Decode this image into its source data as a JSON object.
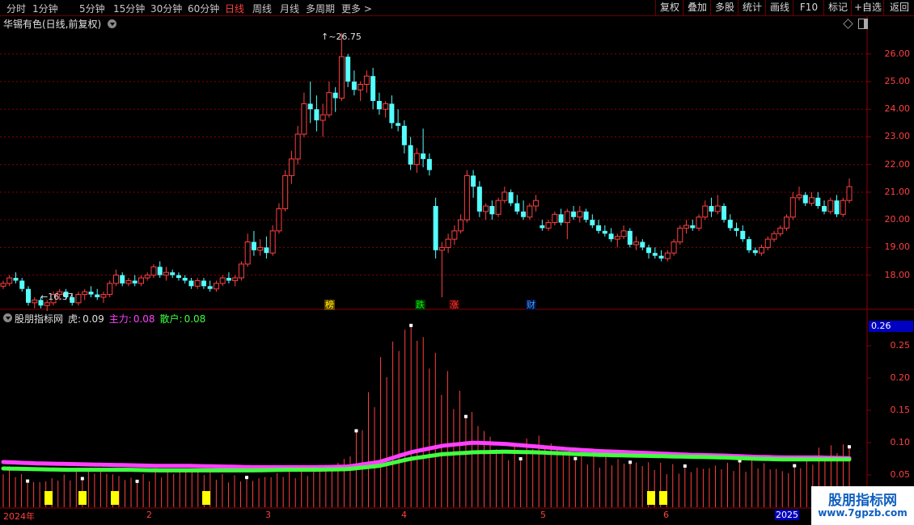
{
  "toolbar": {
    "periods": [
      "分时",
      "1分钟",
      "5分钟",
      "15分钟",
      "30分钟",
      "60分钟",
      "日线",
      "周线",
      "月线",
      "多周期",
      "更多 >"
    ],
    "active_period": "日线",
    "buttons": [
      "复权",
      "叠加",
      "多股",
      "统计",
      "画线",
      "F10",
      "标记",
      "+自选",
      "返回"
    ]
  },
  "stock": {
    "title": "华锡有色(日线,前复权)"
  },
  "price_axis": {
    "ticks": [
      "26.00",
      "25.00",
      "24.00",
      "23.00",
      "22.00",
      "21.00",
      "20.00",
      "19.00",
      "18.00"
    ]
  },
  "annotations": {
    "high": "26.75",
    "low": "16.57"
  },
  "tags": [
    {
      "text": "榜",
      "color": "#ffff00",
      "bg": "#604000"
    },
    {
      "text": "跌",
      "color": "#00ff00",
      "bg": "#003000"
    },
    {
      "text": "涨",
      "color": "#ff4040",
      "bg": "#400000"
    },
    {
      "text": "财",
      "color": "#40a0ff",
      "bg": "#001040"
    }
  ],
  "indicator": {
    "name": "股朋指标网",
    "tiger": {
      "label": "虎:",
      "value": "0.09"
    },
    "main_force": {
      "label": "主力:",
      "value": "0.08"
    },
    "retail": {
      "label": "散户:",
      "value": "0.08"
    },
    "current_value": "0.26",
    "ticks": [
      "0.25",
      "0.20",
      "0.15",
      "0.10",
      "0.05"
    ]
  },
  "time_axis": {
    "labels": [
      "2024年",
      "2",
      "3",
      "4",
      "5",
      "6"
    ],
    "year_box": "2025"
  },
  "watermark": {
    "line1": "股朋指标网",
    "line2": "www.7gpzb.com"
  },
  "colors": {
    "up": "#ff4040",
    "down": "#54ffff",
    "main_force": "#ff40ff",
    "retail": "#40ff40",
    "grid": "#8b0000"
  },
  "chart_data": [
    {
      "type": "candlestick",
      "title": "华锡有色(日线,前复权)",
      "ylim": [
        17.2,
        26.9
      ],
      "ohlc": [
        [
          17.6,
          17.8,
          17.5,
          17.7
        ],
        [
          17.7,
          18.0,
          17.6,
          17.9
        ],
        [
          17.9,
          18.1,
          17.7,
          17.8
        ],
        [
          17.8,
          17.9,
          17.4,
          17.5
        ],
        [
          17.5,
          17.6,
          16.9,
          17.0
        ],
        [
          17.0,
          17.2,
          16.8,
          17.1
        ],
        [
          17.1,
          17.2,
          16.8,
          16.9
        ],
        [
          16.9,
          17.1,
          16.7,
          17.0
        ],
        [
          17.0,
          17.4,
          16.9,
          17.3
        ],
        [
          17.3,
          17.5,
          17.1,
          17.4
        ],
        [
          17.4,
          17.5,
          17.1,
          17.2
        ],
        [
          17.2,
          17.3,
          16.9,
          17.0
        ],
        [
          17.0,
          17.4,
          16.9,
          17.3
        ],
        [
          17.3,
          17.5,
          17.1,
          17.4
        ],
        [
          17.4,
          17.6,
          17.2,
          17.3
        ],
        [
          17.3,
          17.5,
          17.1,
          17.2
        ],
        [
          17.2,
          17.4,
          17.0,
          17.3
        ],
        [
          17.3,
          17.8,
          17.2,
          17.7
        ],
        [
          17.7,
          18.2,
          17.6,
          18.0
        ],
        [
          18.0,
          18.1,
          17.6,
          17.7
        ],
        [
          17.7,
          17.9,
          17.6,
          17.8
        ],
        [
          17.8,
          18.0,
          17.6,
          17.7
        ],
        [
          17.7,
          18.0,
          17.6,
          17.9
        ],
        [
          17.9,
          18.1,
          17.8,
          18.0
        ],
        [
          18.0,
          18.4,
          17.9,
          18.3
        ],
        [
          18.3,
          18.5,
          17.9,
          18.0
        ],
        [
          18.0,
          18.3,
          17.8,
          18.1
        ],
        [
          18.1,
          18.2,
          17.9,
          18.0
        ],
        [
          18.0,
          18.1,
          17.8,
          17.9
        ],
        [
          17.9,
          18.0,
          17.7,
          17.8
        ],
        [
          17.8,
          17.9,
          17.5,
          17.6
        ],
        [
          17.6,
          17.9,
          17.5,
          17.8
        ],
        [
          17.8,
          17.9,
          17.5,
          17.6
        ],
        [
          17.6,
          17.8,
          17.4,
          17.5
        ],
        [
          17.5,
          17.8,
          17.4,
          17.7
        ],
        [
          17.7,
          18.0,
          17.6,
          17.9
        ],
        [
          17.9,
          18.1,
          17.7,
          17.8
        ],
        [
          17.8,
          18.0,
          17.6,
          17.9
        ],
        [
          17.9,
          18.5,
          17.8,
          18.4
        ],
        [
          18.4,
          19.5,
          18.3,
          19.2
        ],
        [
          19.2,
          19.6,
          18.7,
          18.9
        ],
        [
          18.9,
          19.3,
          18.7,
          19.0
        ],
        [
          19.0,
          19.4,
          18.6,
          18.8
        ],
        [
          18.8,
          19.8,
          18.7,
          19.6
        ],
        [
          19.6,
          20.6,
          19.5,
          20.4
        ],
        [
          20.4,
          21.8,
          20.3,
          21.6
        ],
        [
          21.6,
          22.5,
          21.3,
          22.2
        ],
        [
          22.2,
          23.4,
          22.0,
          23.1
        ],
        [
          23.1,
          24.6,
          23.0,
          24.2
        ],
        [
          24.2,
          25.0,
          23.5,
          24.0
        ],
        [
          24.0,
          24.5,
          23.2,
          23.6
        ],
        [
          23.6,
          24.2,
          23.0,
          23.8
        ],
        [
          23.8,
          25.0,
          23.7,
          24.6
        ],
        [
          24.6,
          24.8,
          23.9,
          24.4
        ],
        [
          24.4,
          26.75,
          24.3,
          25.9
        ],
        [
          25.9,
          26.0,
          24.8,
          25.0
        ],
        [
          25.0,
          25.4,
          24.5,
          24.7
        ],
        [
          24.7,
          25.0,
          24.3,
          24.9
        ],
        [
          24.9,
          25.4,
          24.6,
          25.2
        ],
        [
          25.2,
          25.5,
          24.0,
          24.3
        ],
        [
          24.3,
          24.6,
          23.8,
          24.0
        ],
        [
          24.0,
          24.3,
          23.7,
          24.2
        ],
        [
          24.2,
          24.5,
          23.3,
          23.5
        ],
        [
          23.5,
          24.0,
          23.2,
          23.4
        ],
        [
          23.4,
          23.6,
          22.4,
          22.7
        ],
        [
          22.7,
          23.0,
          21.8,
          22.0
        ],
        [
          22.0,
          22.6,
          21.7,
          22.4
        ],
        [
          22.4,
          23.3,
          21.9,
          22.2
        ],
        [
          22.2,
          22.4,
          21.6,
          21.8
        ],
        [
          20.5,
          20.8,
          18.6,
          18.9
        ],
        [
          18.9,
          19.2,
          17.2,
          19.0
        ],
        [
          19.0,
          19.5,
          18.8,
          19.3
        ],
        [
          19.3,
          19.8,
          19.1,
          19.6
        ],
        [
          19.6,
          20.2,
          19.5,
          20.0
        ],
        [
          20.0,
          21.8,
          19.9,
          21.6
        ],
        [
          21.6,
          21.8,
          20.8,
          21.2
        ],
        [
          21.2,
          21.4,
          20.1,
          20.3
        ],
        [
          20.3,
          20.6,
          20.0,
          20.5
        ],
        [
          20.5,
          20.7,
          20.0,
          20.2
        ],
        [
          20.2,
          20.8,
          20.1,
          20.7
        ],
        [
          20.7,
          21.2,
          20.6,
          21.0
        ],
        [
          21.0,
          21.1,
          20.5,
          20.6
        ],
        [
          20.6,
          20.9,
          20.2,
          20.3
        ],
        [
          20.3,
          20.7,
          20.0,
          20.1
        ],
        [
          20.1,
          20.6,
          20.0,
          20.5
        ],
        [
          20.5,
          20.9,
          20.3,
          20.7
        ],
        [
          19.8,
          20.0,
          19.6,
          19.7
        ],
        [
          19.7,
          20.0,
          19.6,
          19.9
        ],
        [
          19.9,
          20.3,
          19.8,
          20.2
        ],
        [
          20.2,
          20.4,
          19.8,
          19.9
        ],
        [
          19.9,
          20.4,
          19.3,
          20.3
        ],
        [
          20.3,
          20.5,
          20.0,
          20.1
        ],
        [
          20.1,
          20.5,
          19.9,
          20.3
        ],
        [
          20.3,
          20.4,
          19.9,
          20.0
        ],
        [
          20.0,
          20.2,
          19.7,
          19.8
        ],
        [
          19.8,
          20.0,
          19.5,
          19.6
        ],
        [
          19.6,
          19.8,
          19.4,
          19.5
        ],
        [
          19.5,
          19.7,
          19.2,
          19.3
        ],
        [
          19.3,
          19.5,
          19.0,
          19.4
        ],
        [
          19.4,
          19.8,
          19.3,
          19.6
        ],
        [
          19.6,
          19.7,
          19.0,
          19.1
        ],
        [
          19.1,
          19.4,
          18.9,
          19.2
        ],
        [
          19.2,
          19.3,
          18.9,
          19.0
        ],
        [
          19.0,
          19.1,
          18.6,
          18.8
        ],
        [
          18.8,
          19.0,
          18.6,
          18.7
        ],
        [
          18.7,
          18.9,
          18.5,
          18.6
        ],
        [
          18.6,
          18.9,
          18.5,
          18.8
        ],
        [
          18.8,
          19.3,
          18.7,
          19.2
        ],
        [
          19.2,
          19.8,
          19.1,
          19.7
        ],
        [
          19.7,
          20.0,
          19.5,
          19.8
        ],
        [
          19.8,
          20.0,
          19.6,
          19.7
        ],
        [
          19.7,
          20.2,
          19.6,
          20.1
        ],
        [
          20.1,
          20.7,
          20.0,
          20.5
        ],
        [
          20.5,
          20.8,
          20.1,
          20.3
        ],
        [
          20.3,
          20.9,
          20.2,
          20.5
        ],
        [
          20.5,
          20.6,
          19.9,
          20.0
        ],
        [
          20.0,
          20.2,
          19.6,
          19.7
        ],
        [
          19.7,
          19.9,
          19.4,
          19.6
        ],
        [
          19.6,
          19.8,
          19.2,
          19.3
        ],
        [
          19.3,
          19.4,
          18.8,
          18.9
        ],
        [
          18.9,
          19.0,
          18.7,
          18.8
        ],
        [
          18.8,
          19.1,
          18.7,
          19.0
        ],
        [
          19.0,
          19.4,
          18.9,
          19.3
        ],
        [
          19.3,
          19.6,
          19.2,
          19.5
        ],
        [
          19.5,
          19.8,
          19.4,
          19.7
        ],
        [
          19.7,
          20.2,
          19.6,
          20.1
        ],
        [
          20.1,
          21.0,
          20.0,
          20.8
        ],
        [
          20.8,
          21.2,
          20.7,
          20.9
        ],
        [
          20.9,
          21.0,
          20.5,
          20.6
        ],
        [
          20.6,
          21.0,
          20.5,
          20.8
        ],
        [
          20.8,
          21.0,
          20.4,
          20.5
        ],
        [
          20.5,
          20.7,
          20.2,
          20.3
        ],
        [
          20.3,
          20.8,
          20.2,
          20.7
        ],
        [
          20.7,
          20.9,
          20.1,
          20.2
        ],
        [
          20.2,
          20.8,
          20.1,
          20.7
        ],
        [
          20.7,
          21.5,
          20.6,
          21.2
        ]
      ]
    },
    {
      "type": "line",
      "title": "股朋指标网",
      "ylim": [
        0.0,
        0.27
      ],
      "series": [
        {
          "name": "主力",
          "values": [
            0.07,
            0.068,
            0.067,
            0.066,
            0.065,
            0.064,
            0.064,
            0.063,
            0.062,
            0.062,
            0.062,
            0.063,
            0.07,
            0.085,
            0.095,
            0.1,
            0.098,
            0.094,
            0.09,
            0.087,
            0.085,
            0.083,
            0.081,
            0.08,
            0.078,
            0.077,
            0.077,
            0.076
          ]
        },
        {
          "name": "散户",
          "values": [
            0.06,
            0.059,
            0.058,
            0.058,
            0.058,
            0.057,
            0.057,
            0.057,
            0.057,
            0.058,
            0.058,
            0.059,
            0.064,
            0.075,
            0.082,
            0.085,
            0.086,
            0.085,
            0.083,
            0.081,
            0.08,
            0.079,
            0.078,
            0.077,
            0.075,
            0.074,
            0.074,
            0.074
          ]
        },
        {
          "name": "虎",
          "values": [
            0.06,
            0.035,
            0.045,
            0.055,
            0.04,
            0.05,
            0.055,
            0.045,
            0.04,
            0.05,
            0.055,
            0.07,
            0.2,
            0.265,
            0.195,
            0.13,
            0.075,
            0.1,
            0.08,
            0.07,
            0.065,
            0.06,
            0.055,
            0.06,
            0.065,
            0.05,
            0.08,
            0.09
          ]
        }
      ],
      "signals": [
        1,
        3,
        6,
        13,
        42,
        43
      ]
    }
  ]
}
